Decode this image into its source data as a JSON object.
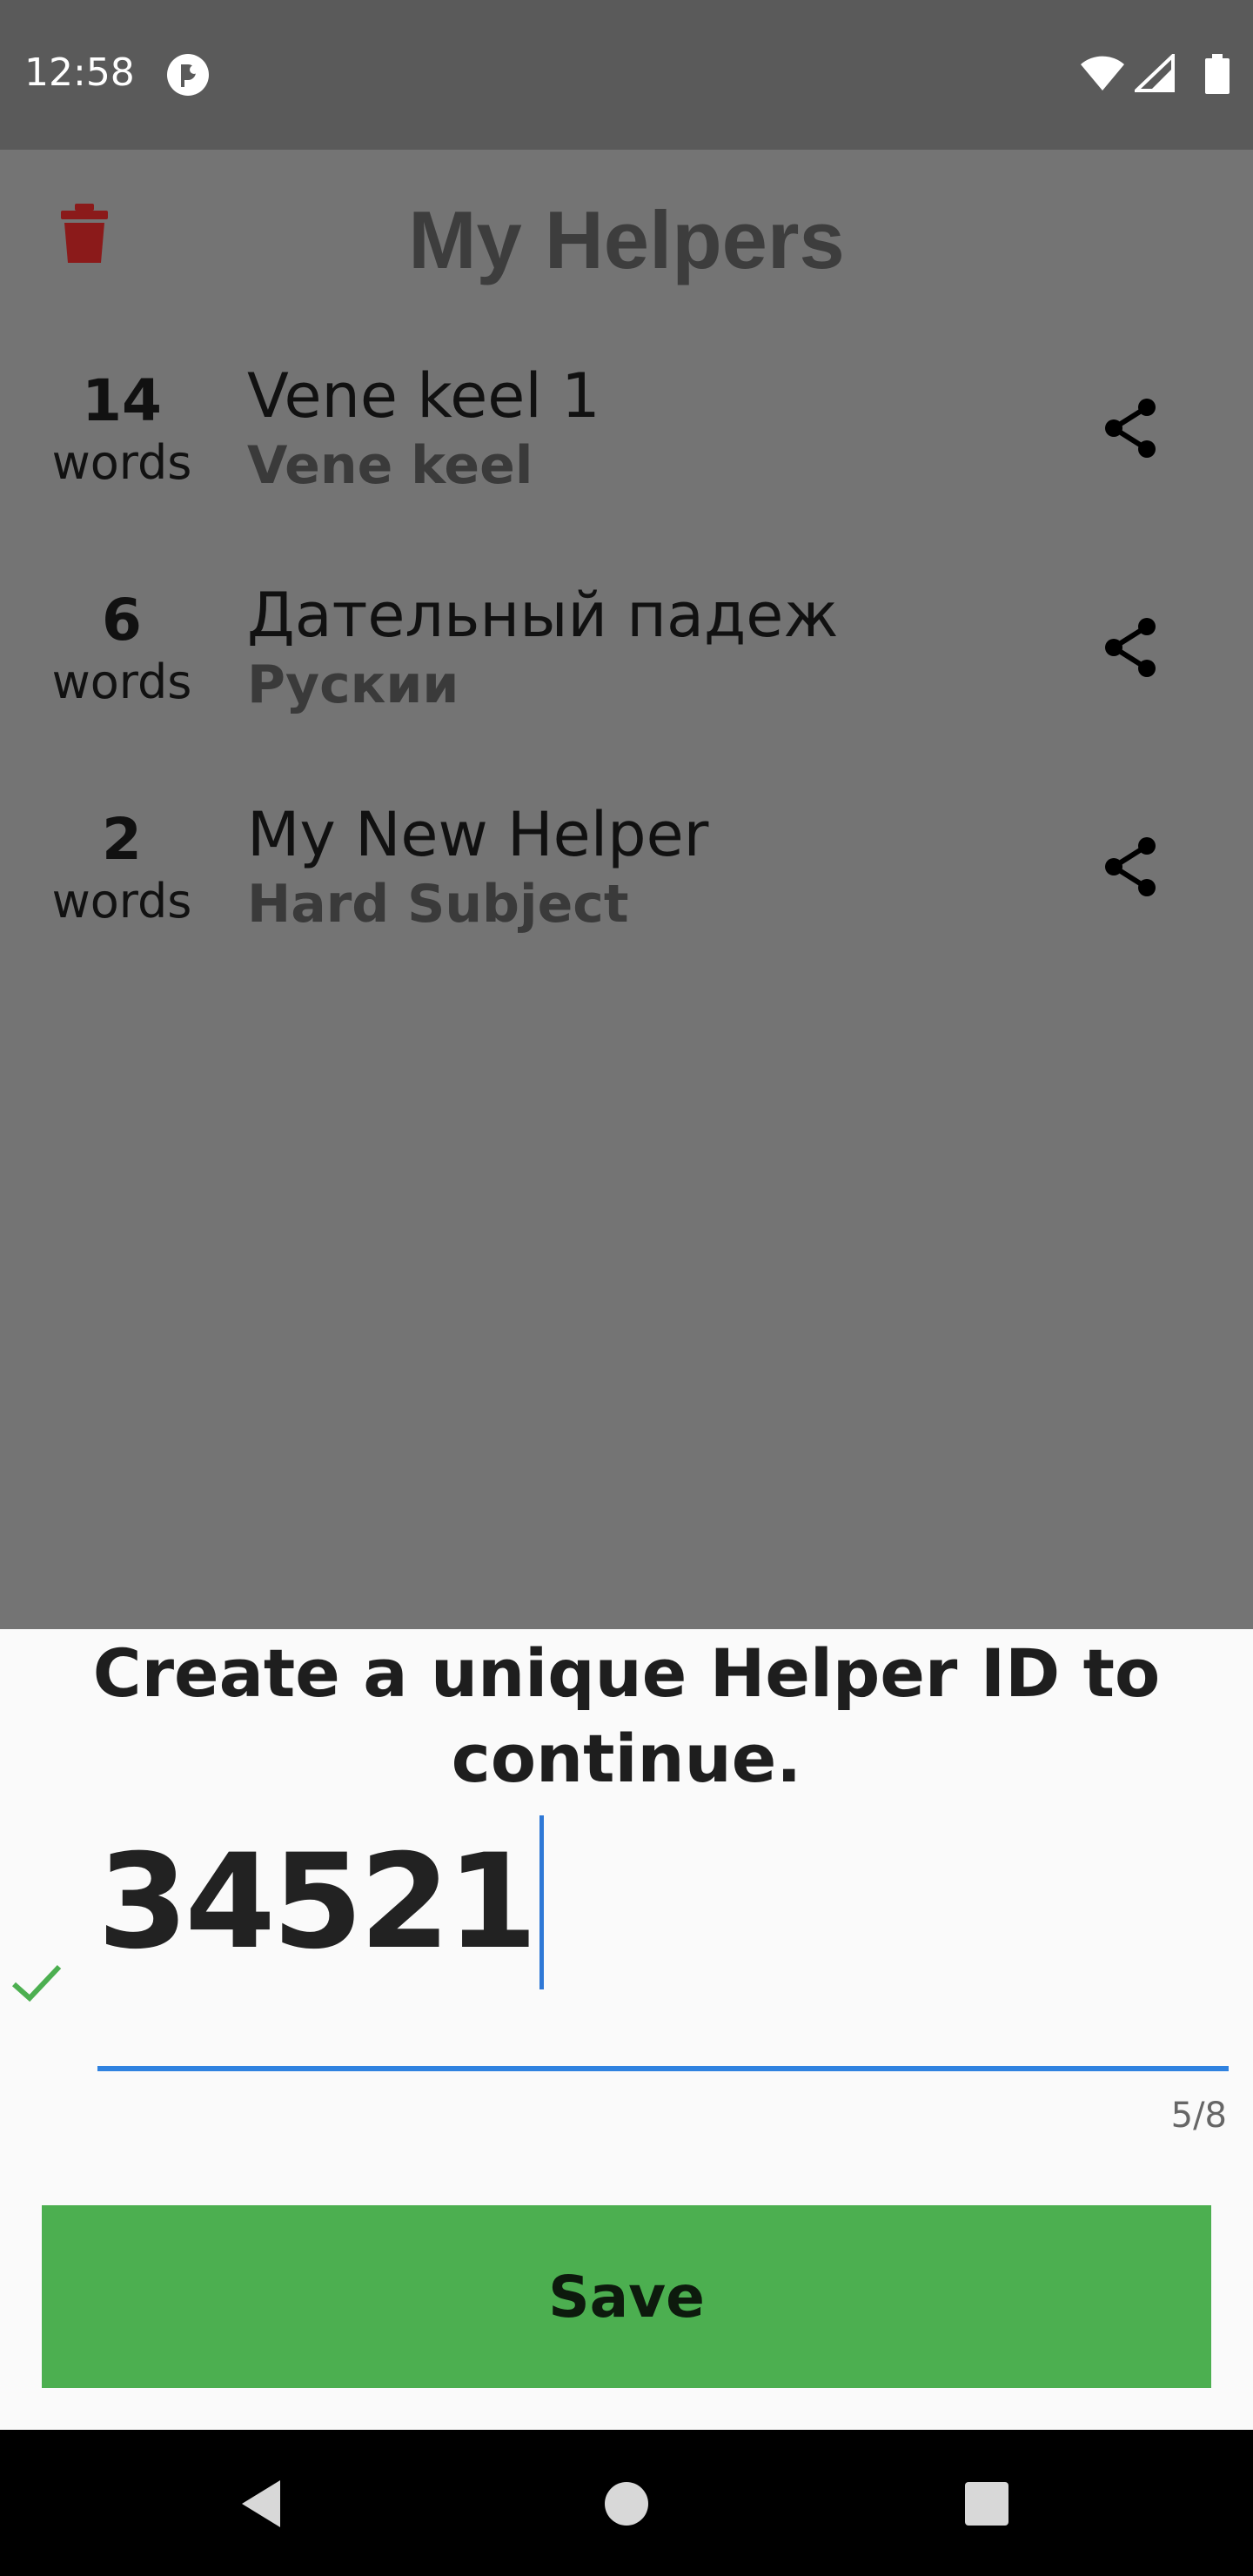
{
  "status_bar": {
    "time": "12:58",
    "icons": [
      "app-notification-icon",
      "wifi-icon",
      "cell-signal-icon",
      "battery-icon"
    ]
  },
  "header": {
    "title": "My Helpers",
    "delete_icon": "trash-icon"
  },
  "helpers": [
    {
      "count": "14",
      "count_label": "words",
      "name": "Vene keel 1",
      "subject": "Vene keel"
    },
    {
      "count": "6",
      "count_label": "words",
      "name": "Дательный падеж",
      "subject": "Рускии"
    },
    {
      "count": "2",
      "count_label": "words",
      "name": "My New Helper",
      "subject": "Hard Subject"
    }
  ],
  "dialog": {
    "prompt": "Create a unique Helper ID to continue.",
    "id_value": "34521",
    "char_counter": "5/8",
    "save_label": "Save"
  },
  "colors": {
    "accent": "#2f82e0",
    "save_button": "#4caf50",
    "valid_check": "#4caf50",
    "trash": "#8b1a1a",
    "scrim": "#747474"
  },
  "nav_bar": [
    "back-icon",
    "home-icon",
    "recents-icon"
  ]
}
